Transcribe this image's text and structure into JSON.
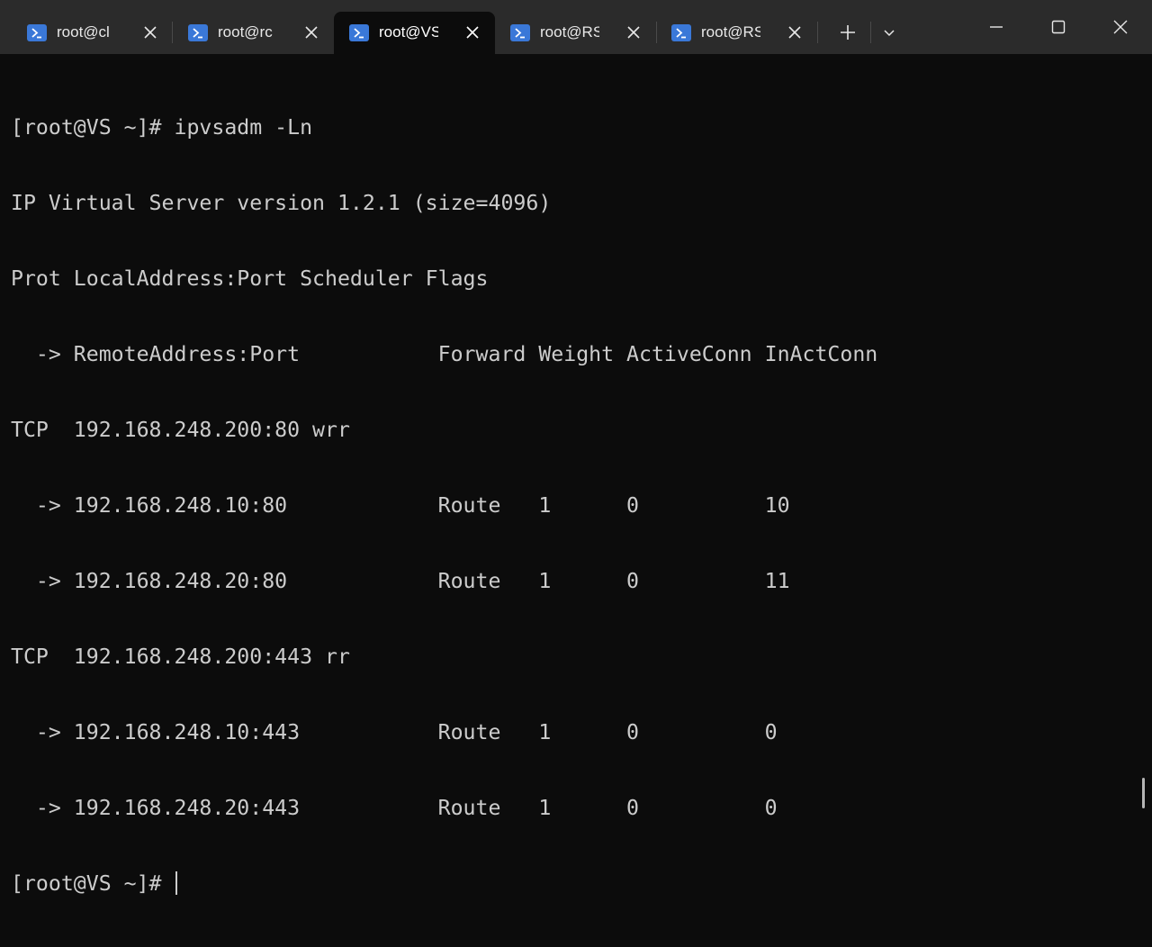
{
  "tabs": [
    {
      "label": "root@cl",
      "icon": "powershell-icon",
      "active": false
    },
    {
      "label": "root@rc",
      "icon": "powershell-icon",
      "active": false
    },
    {
      "label": "root@VS",
      "icon": "powershell-icon",
      "active": true
    },
    {
      "label": "root@RS",
      "icon": "powershell-icon",
      "active": false
    },
    {
      "label": "root@RS",
      "icon": "powershell-icon",
      "active": false
    }
  ],
  "window_controls": {
    "new_tab": "+",
    "dropdown": "chevron-down-icon",
    "minimize": "minimize-icon",
    "maximize": "maximize-icon",
    "close": "close-icon"
  },
  "terminal": {
    "lines": [
      "[root@VS ~]# ipvsadm -Ln",
      "IP Virtual Server version 1.2.1 (size=4096)",
      "Prot LocalAddress:Port Scheduler Flags",
      "  -> RemoteAddress:Port           Forward Weight ActiveConn InActConn",
      "TCP  192.168.248.200:80 wrr",
      "  -> 192.168.248.10:80            Route   1      0          10",
      "  -> 192.168.248.20:80            Route   1      0          11",
      "TCP  192.168.248.200:443 rr",
      "  -> 192.168.248.10:443           Route   1      0          0",
      "  -> 192.168.248.20:443           Route   1      0          0"
    ],
    "prompt": "[root@VS ~]# "
  },
  "colors": {
    "titlebar": "#2b2b2b",
    "terminal_bg": "#0c0c0c",
    "terminal_fg": "#cccccc",
    "tab_icon": "#3a78d8"
  }
}
